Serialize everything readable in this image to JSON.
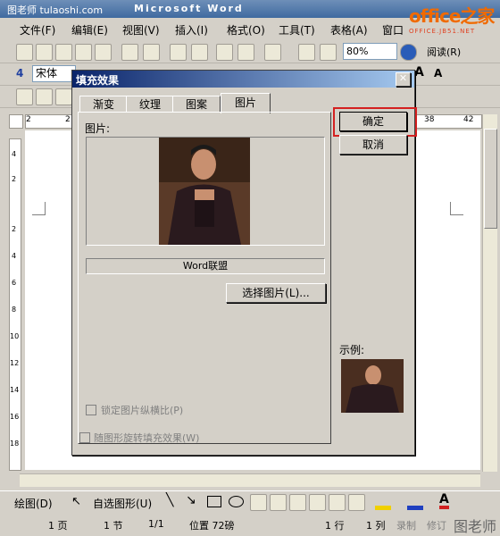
{
  "window": {
    "title": "Microsoft Word",
    "watermark": "图老师 tulaoshi.com",
    "logo_main": "office之家",
    "logo_sub": "OFFICE.JB51.NET"
  },
  "menu": [
    "文件(F)",
    "编辑(E)",
    "视图(V)",
    "插入(I)",
    "格式(O)",
    "工具(T)",
    "表格(A)",
    "窗口"
  ],
  "toolbar": {
    "zoom": "80%",
    "read_label": "阅读(R)",
    "font_name": "宋体"
  },
  "ruler": {
    "left_num": "2",
    "left_num2": "2",
    "right_num1": "38",
    "right_num2": "42"
  },
  "vruler_nums": [
    "4",
    "2",
    "2",
    "4",
    "6",
    "8",
    "10",
    "12",
    "14",
    "16",
    "18"
  ],
  "dialog": {
    "title": "填充效果",
    "tabs": [
      "渐变",
      "纹理",
      "图案",
      "图片"
    ],
    "picture_label": "图片:",
    "picture_name": "Word联盟",
    "select_picture_button": "选择图片(L)...",
    "lock_aspect_label": "锁定图片纵横比(P)",
    "rotate_fill_label": "随图形旋转填充效果(W)",
    "ok_button": "确定",
    "cancel_button": "取消",
    "sample_label": "示例:"
  },
  "drawbar": {
    "draw_label": "绘图(D)",
    "autoshape_label": "自选图形(U)"
  },
  "status": {
    "page": "1 页",
    "section": "1 节",
    "page_of": "1/1",
    "position": "位置 72磅",
    "line": "1 行",
    "column": "1 列",
    "record": "录制",
    "revise": "修订",
    "corner_watermark": "图老师"
  },
  "colors": {
    "highlight_border": "#d42020",
    "dialog_title_start": "#0a246a",
    "dialog_title_end": "#a6caf0"
  }
}
